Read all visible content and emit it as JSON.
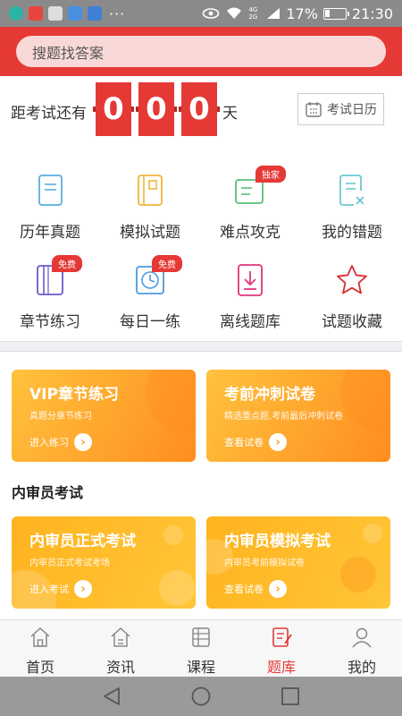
{
  "status_bar": {
    "battery": "17%",
    "time": "21:30",
    "network": "4G 2G",
    "notif_app_label": "临邑网校",
    "more": "···"
  },
  "search": {
    "placeholder": "搜题找答案"
  },
  "countdown": {
    "label": "距考试还有",
    "digits": [
      "0",
      "0",
      "0"
    ],
    "unit": "天",
    "calendar_button": "考试日历"
  },
  "features": [
    {
      "label": "历年真题",
      "badge": ""
    },
    {
      "label": "模拟试题",
      "badge": ""
    },
    {
      "label": "难点攻克",
      "badge": "独家"
    },
    {
      "label": "我的错题",
      "badge": ""
    },
    {
      "label": "章节练习",
      "badge": "免费"
    },
    {
      "label": "每日一练",
      "badge": "免费"
    },
    {
      "label": "离线题库",
      "badge": ""
    },
    {
      "label": "试题收藏",
      "badge": ""
    }
  ],
  "promo_cards": [
    {
      "title": "VIP章节练习",
      "subtitle": "真题分章节练习",
      "action": "进入练习"
    },
    {
      "title": "考前冲刺试卷",
      "subtitle": "精选重点题,考前最后冲刺试卷",
      "action": "查看试卷"
    }
  ],
  "section": {
    "title": "内审员考试"
  },
  "exam_cards": [
    {
      "title": "内审员正式考试",
      "subtitle": "内审员正式考试考场",
      "action": "进入考试"
    },
    {
      "title": "内审员模拟考试",
      "subtitle": "内审员考前模拟试卷",
      "action": "查看试卷"
    }
  ],
  "bottom_nav": [
    {
      "label": "首页",
      "active": false
    },
    {
      "label": "资讯",
      "active": false
    },
    {
      "label": "课程",
      "active": false
    },
    {
      "label": "题库",
      "active": true
    },
    {
      "label": "我的",
      "active": false
    }
  ],
  "colors": {
    "brand_red": "#e53935",
    "card_orange": "#ff8d1f",
    "card_yellow": "#ffc23d"
  }
}
